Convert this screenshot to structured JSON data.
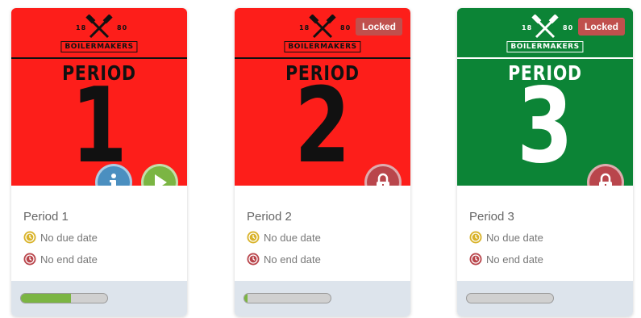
{
  "logo": {
    "brand": "BOILERMAKERS",
    "year_left": "18",
    "year_right": "80"
  },
  "cards": [
    {
      "period_word": "PERIOD",
      "number": "1",
      "title": "Period 1",
      "due": "No due date",
      "end": "No end date",
      "locked": false,
      "locked_label": "",
      "progress": 0.58,
      "bg_color": "#fd1e1a",
      "fg_color": "#111111",
      "actions": [
        "info-icon",
        "play-icon"
      ]
    },
    {
      "period_word": "PERIOD",
      "number": "2",
      "title": "Period 2",
      "due": "No due date",
      "end": "No end date",
      "locked": true,
      "locked_label": "Locked",
      "progress": 0.04,
      "bg_color": "#fd1e1a",
      "fg_color": "#111111",
      "actions": [
        "lock-icon"
      ]
    },
    {
      "period_word": "PERIOD",
      "number": "3",
      "title": "Period 3",
      "due": "No due date",
      "end": "No end date",
      "locked": true,
      "locked_label": "Locked",
      "progress": 0.0,
      "bg_color": "#0c8436",
      "fg_color": "#ffffff",
      "actions": [
        "lock-icon"
      ]
    }
  ],
  "colors": {
    "info": "#4b8fc0",
    "play": "#7bb543",
    "lock": "#b9464c",
    "due_icon": "#d9b32a",
    "end_icon": "#b9464c",
    "footer": "#dde4ec",
    "locked_badge": "#c0504d"
  }
}
